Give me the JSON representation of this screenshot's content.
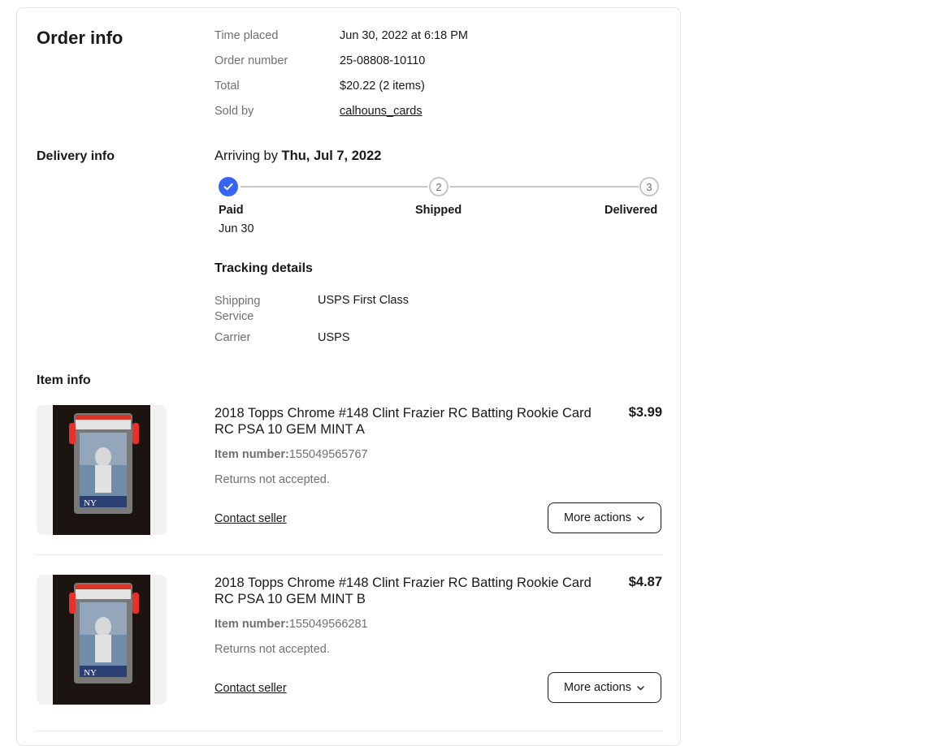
{
  "order_info": {
    "heading": "Order info",
    "rows": [
      {
        "label": "Time placed",
        "value": "Jun 30, 2022 at 6:18 PM"
      },
      {
        "label": "Order number",
        "value": "25-08808-10110"
      },
      {
        "label": "Total",
        "value": "$20.22 (2 items)"
      },
      {
        "label": "Sold by",
        "value": "calhouns_cards"
      }
    ]
  },
  "delivery_info": {
    "heading": "Delivery info",
    "arriving_prefix": "Arriving by",
    "arriving_date": "Thu, Jul 7, 2022",
    "steps": [
      {
        "label": "Paid",
        "date": "Jun 30",
        "status": "complete",
        "icon": "check-icon"
      },
      {
        "label": "Shipped",
        "number": "2",
        "status": "pending"
      },
      {
        "label": "Delivered",
        "number": "3",
        "status": "pending"
      }
    ],
    "tracking": {
      "heading": "Tracking details",
      "rows": [
        {
          "label": "Shipping Service",
          "value": "USPS First Class"
        },
        {
          "label": "Carrier",
          "value": "USPS"
        }
      ]
    }
  },
  "item_info": {
    "heading": "Item info",
    "items": [
      {
        "title": "2018 Topps Chrome #148 Clint Frazier RC Batting Rookie Card RC PSA 10 GEM MINT A",
        "price": "$3.99",
        "item_number_label": "Item number:",
        "item_number": "155049565767",
        "returns": "Returns not accepted.",
        "contact_label": "Contact seller",
        "more_actions_label": "More actions"
      },
      {
        "title": "2018 Topps Chrome #148 Clint Frazier RC Batting Rookie Card RC PSA 10 GEM MINT B",
        "price": "$4.87",
        "item_number_label": "Item number:",
        "item_number": "155049566281",
        "returns": "Returns not accepted.",
        "contact_label": "Contact seller",
        "more_actions_label": "More actions"
      }
    ]
  },
  "colors": {
    "accent": "#3665f3",
    "text": "#191919",
    "muted": "#707070",
    "border": "#e5e5e5"
  }
}
